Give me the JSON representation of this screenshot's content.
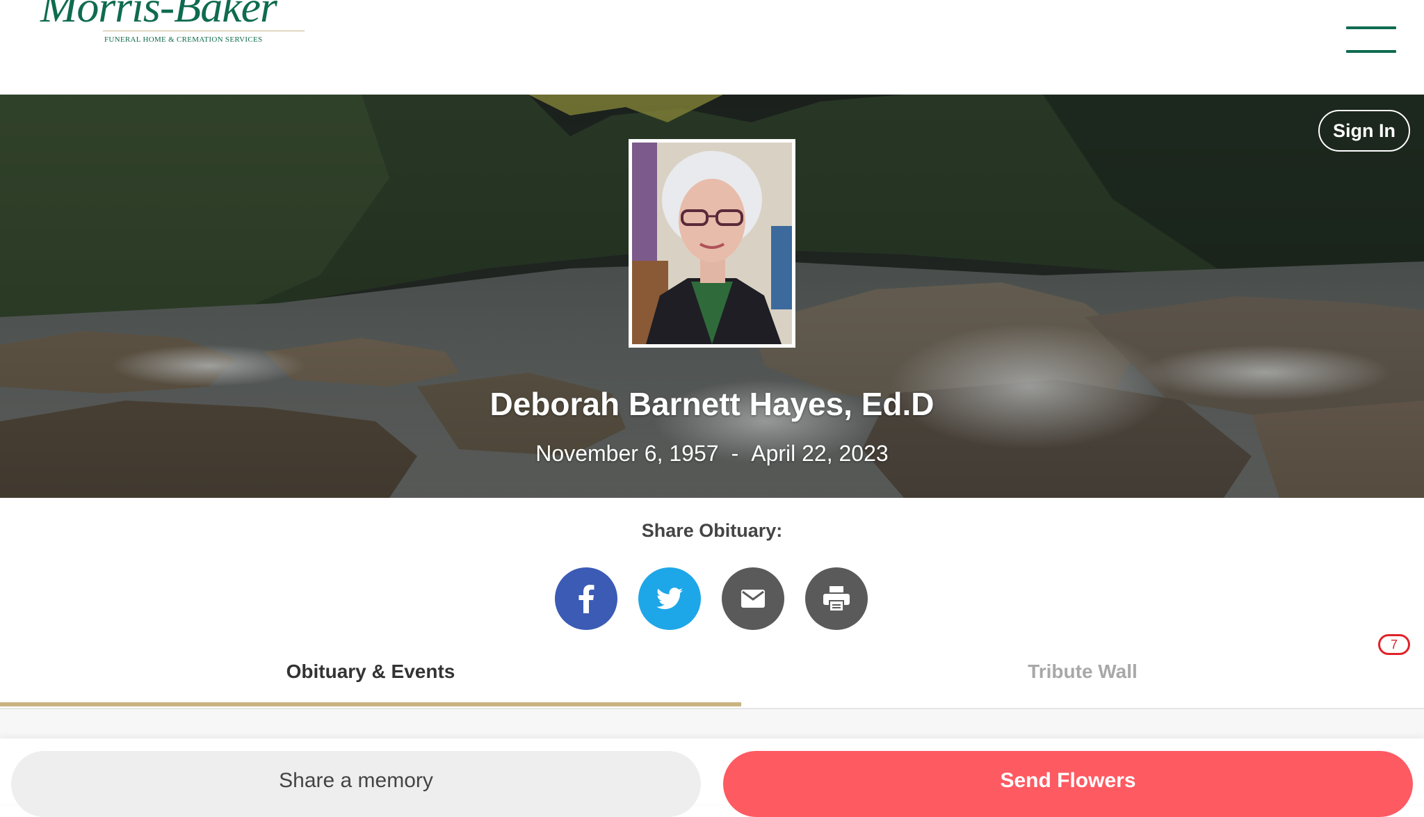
{
  "header": {
    "logo_name": "Morris-Baker",
    "logo_tagline": "FUNERAL HOME & CREMATION SERVICES",
    "brand_color": "#0f6b4f",
    "menu_icon": "hamburger-menu-icon"
  },
  "hero": {
    "sign_in_label": "Sign In",
    "name": "Deborah Barnett Hayes, Ed.D",
    "birth_date": "November 6, 1957",
    "date_separator": "-",
    "death_date": "April 22, 2023"
  },
  "share": {
    "label": "Share Obituary:",
    "buttons": [
      {
        "icon": "facebook-icon",
        "color": "#3b5bb5"
      },
      {
        "icon": "twitter-icon",
        "color": "#1da7e8"
      },
      {
        "icon": "email-icon",
        "color": "#5a5a5a"
      },
      {
        "icon": "print-icon",
        "color": "#5a5a5a"
      }
    ]
  },
  "tabs": {
    "obituary_label": "Obituary & Events",
    "tribute_label": "Tribute Wall",
    "tribute_count": "7",
    "active_tab": "Obituary & Events",
    "active_color": "#c9b481"
  },
  "actions": {
    "share_memory_label": "Share a memory",
    "send_flowers_label": "Send Flowers",
    "send_flowers_color": "#fe5a62"
  }
}
